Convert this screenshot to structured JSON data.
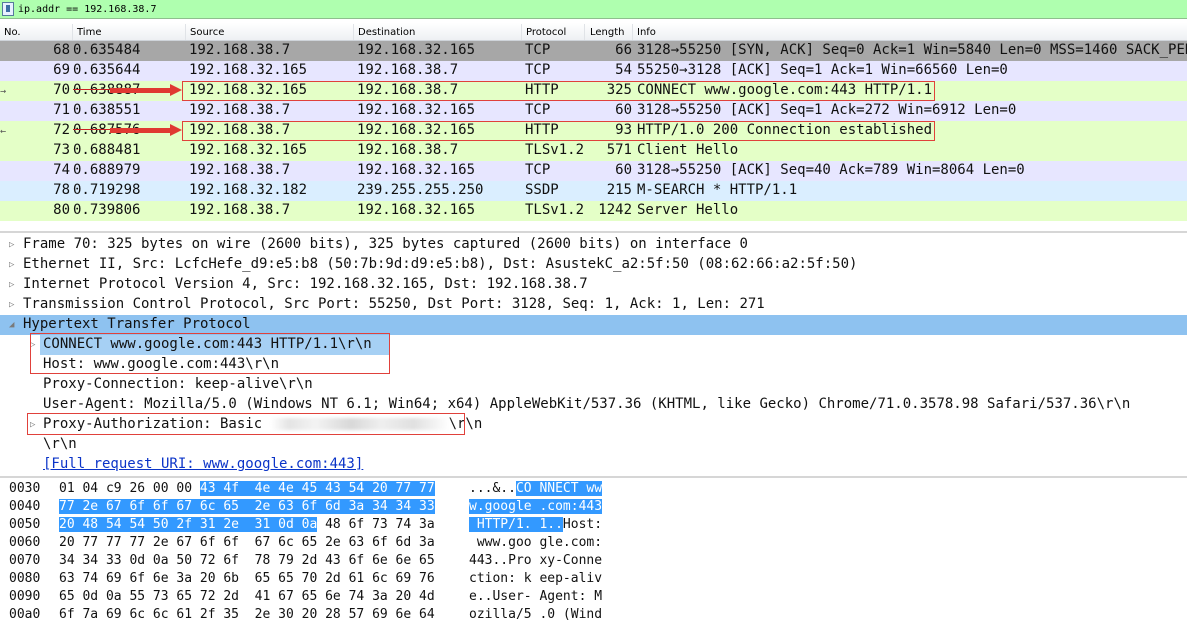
{
  "filter": {
    "value": "ip.addr == 192.168.38.7"
  },
  "columns": [
    "No.",
    "Time",
    "Source",
    "Destination",
    "Protocol",
    "Length",
    "Info"
  ],
  "colors": {
    "gray": "#a7a7a7",
    "lavender": "#e7e6ff",
    "green": "#e4ffc7",
    "blue_light": "#daeeff",
    "selected_detail": "#8ec2f0",
    "hex_highlight": "#3399ff",
    "annotation_red": "#e0413b"
  },
  "packets": [
    {
      "no": "68",
      "time": "0.635484",
      "src": "192.168.38.7",
      "dst": "192.168.32.165",
      "proto": "TCP",
      "len": "66",
      "info": "3128→55250 [SYN, ACK] Seq=0 Ack=1 Win=5840 Len=0 MSS=1460 SACK_PERM=1",
      "bg": "#a7a7a7",
      "marker": ""
    },
    {
      "no": "69",
      "time": "0.635644",
      "src": "192.168.32.165",
      "dst": "192.168.38.7",
      "proto": "TCP",
      "len": "54",
      "info": "55250→3128 [ACK] Seq=1 Ack=1 Win=66560 Len=0",
      "bg": "#e7e6ff",
      "marker": ""
    },
    {
      "no": "70",
      "time": "0.638887",
      "src": "192.168.32.165",
      "dst": "192.168.38.7",
      "proto": "HTTP",
      "len": "325",
      "info": "CONNECT www.google.com:443 HTTP/1.1",
      "bg": "#e4ffc7",
      "marker": "→"
    },
    {
      "no": "71",
      "time": "0.638551",
      "src": "192.168.38.7",
      "dst": "192.168.32.165",
      "proto": "TCP",
      "len": "60",
      "info": "3128→55250 [ACK] Seq=1 Ack=272 Win=6912 Len=0",
      "bg": "#e7e6ff",
      "marker": ""
    },
    {
      "no": "72",
      "time": "0.687576",
      "src": "192.168.38.7",
      "dst": "192.168.32.165",
      "proto": "HTTP",
      "len": "93",
      "info": "HTTP/1.0 200 Connection established",
      "bg": "#e4ffc7",
      "marker": "←"
    },
    {
      "no": "73",
      "time": "0.688481",
      "src": "192.168.32.165",
      "dst": "192.168.38.7",
      "proto": "TLSv1.2",
      "len": "571",
      "info": "Client Hello",
      "bg": "#e4ffc7",
      "marker": ""
    },
    {
      "no": "74",
      "time": "0.688979",
      "src": "192.168.38.7",
      "dst": "192.168.32.165",
      "proto": "TCP",
      "len": "60",
      "info": "3128→55250 [ACK] Seq=40 Ack=789 Win=8064 Len=0",
      "bg": "#e7e6ff",
      "marker": ""
    },
    {
      "no": "78",
      "time": "0.719298",
      "src": "192.168.32.182",
      "dst": "239.255.255.250",
      "proto": "SSDP",
      "len": "215",
      "info": "M-SEARCH * HTTP/1.1",
      "bg": "#daeeff",
      "marker": ""
    },
    {
      "no": "80",
      "time": "0.739806",
      "src": "192.168.38.7",
      "dst": "192.168.32.165",
      "proto": "TLSv1.2",
      "len": "1242",
      "info": "Server Hello",
      "bg": "#e4ffc7",
      "marker": ""
    }
  ],
  "details": [
    {
      "toggle": "▷",
      "indent": 0,
      "text": "Frame 70: 325 bytes on wire (2600 bits), 325 bytes captured (2600 bits) on interface 0",
      "style": ""
    },
    {
      "toggle": "▷",
      "indent": 0,
      "text": "Ethernet II, Src: LcfcHefe_d9:e5:b8 (50:7b:9d:d9:e5:b8), Dst: AsustekC_a2:5f:50 (08:62:66:a2:5f:50)",
      "style": ""
    },
    {
      "toggle": "▷",
      "indent": 0,
      "text": "Internet Protocol Version 4, Src: 192.168.32.165, Dst: 192.168.38.7",
      "style": ""
    },
    {
      "toggle": "▷",
      "indent": 0,
      "text": "Transmission Control Protocol, Src Port: 55250, Dst Port: 3128, Seq: 1, Ack: 1, Len: 271",
      "style": ""
    },
    {
      "toggle": "◢",
      "indent": 0,
      "text": "Hypertext Transfer Protocol",
      "style": "selected"
    },
    {
      "toggle": "▷",
      "indent": 1,
      "text": "CONNECT www.google.com:443 HTTP/1.1\\r\\n",
      "style": "child-sel"
    },
    {
      "toggle": "",
      "indent": 1,
      "text": "Host: www.google.com:443\\r\\n",
      "style": ""
    },
    {
      "toggle": "",
      "indent": 1,
      "text": "Proxy-Connection: keep-alive\\r\\n",
      "style": ""
    },
    {
      "toggle": "",
      "indent": 1,
      "text": "User-Agent: Mozilla/5.0 (Windows NT 6.1; Win64; x64) AppleWebKit/537.36 (KHTML, like Gecko) Chrome/71.0.3578.98 Safari/537.36\\r\\n",
      "style": ""
    },
    {
      "toggle": "▷",
      "indent": 1,
      "text": "Proxy-Authorization: Basic ",
      "suffix": "\\r\\n",
      "style": "blurred"
    },
    {
      "toggle": "",
      "indent": 1,
      "text": "\\r\\n",
      "style": ""
    },
    {
      "toggle": "",
      "indent": 1,
      "text": "[Full request URI: www.google.com:443]",
      "style": "link"
    }
  ],
  "bytes": [
    {
      "offset": "0030",
      "hex": [
        [
          "01 04 c9 26 00 00 ",
          false
        ],
        [
          "43 4f  4e 4e 45 43 54 20 77 77",
          true
        ]
      ],
      "ascii": [
        [
          "...&..",
          false
        ],
        [
          "CO NNECT ww",
          true
        ]
      ]
    },
    {
      "offset": "0040",
      "hex": [
        [
          "77 2e 67 6f 6f 67 6c 65  2e 63 6f 6d 3a 34 34 33",
          true
        ]
      ],
      "ascii": [
        [
          "w.google .com:443",
          true
        ]
      ]
    },
    {
      "offset": "0050",
      "hex": [
        [
          "20 48 54 54 50 2f 31 2e  31 0d 0a",
          true
        ],
        [
          " 48 6f 73 74 3a",
          false
        ]
      ],
      "ascii": [
        [
          " HTTP/1. 1..",
          true
        ],
        [
          "Host:",
          false
        ]
      ]
    },
    {
      "offset": "0060",
      "hex": [
        [
          "20 77 77 77 2e 67 6f 6f  67 6c 65 2e 63 6f 6d 3a",
          false
        ]
      ],
      "ascii": [
        [
          " www.goo gle.com:",
          false
        ]
      ]
    },
    {
      "offset": "0070",
      "hex": [
        [
          "34 34 33 0d 0a 50 72 6f  78 79 2d 43 6f 6e 6e 65",
          false
        ]
      ],
      "ascii": [
        [
          "443..Pro xy-Conne",
          false
        ]
      ]
    },
    {
      "offset": "0080",
      "hex": [
        [
          "63 74 69 6f 6e 3a 20 6b  65 65 70 2d 61 6c 69 76",
          false
        ]
      ],
      "ascii": [
        [
          "ction: k eep-aliv",
          false
        ]
      ]
    },
    {
      "offset": "0090",
      "hex": [
        [
          "65 0d 0a 55 73 65 72 2d  41 67 65 6e 74 3a 20 4d",
          false
        ]
      ],
      "ascii": [
        [
          "e..User- Agent: M",
          false
        ]
      ]
    },
    {
      "offset": "00a0",
      "hex": [
        [
          "6f 7a 69 6c 6c 61 2f 35  2e 30 20 28 57 69 6e 64",
          false
        ]
      ],
      "ascii": [
        [
          "ozilla/5 .0 (Wind",
          false
        ]
      ]
    }
  ]
}
